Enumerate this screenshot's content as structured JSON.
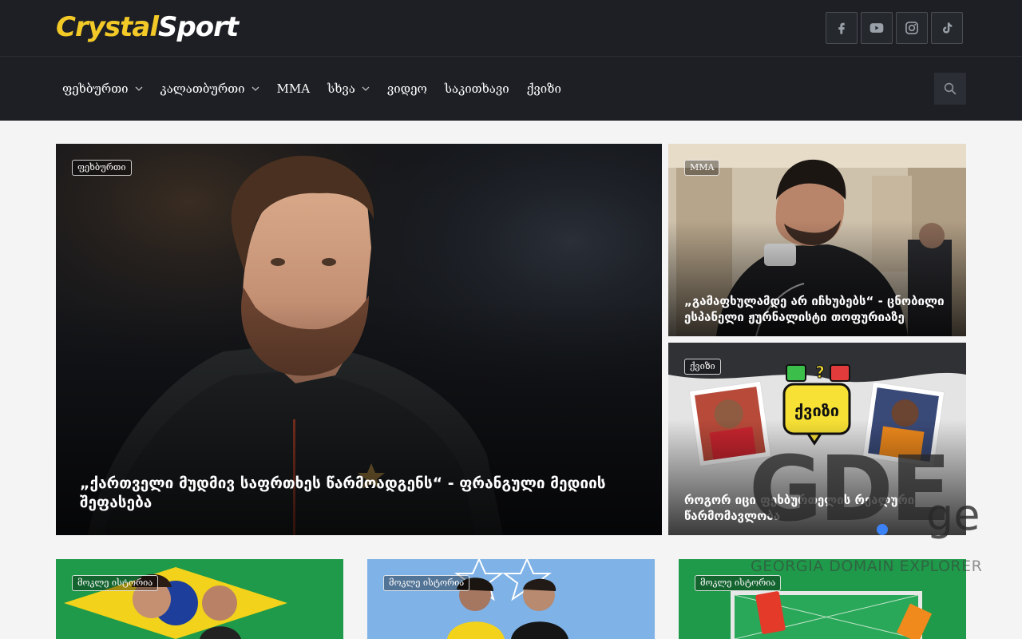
{
  "brand": {
    "logo_part1": "Crystal",
    "logo_part2": "Sport",
    "accent": "#f3c928"
  },
  "socials": [
    {
      "icon": "facebook-icon"
    },
    {
      "icon": "youtube-icon"
    },
    {
      "icon": "instagram-icon"
    },
    {
      "icon": "tiktok-icon"
    }
  ],
  "nav": {
    "items": [
      {
        "label": "ფეხბურთი",
        "has_dropdown": true
      },
      {
        "label": "კალათბურთი",
        "has_dropdown": true
      },
      {
        "label": "MMA",
        "has_dropdown": false
      },
      {
        "label": "სხვა",
        "has_dropdown": true
      },
      {
        "label": "ვიდეო",
        "has_dropdown": false
      },
      {
        "label": "საკითხავი",
        "has_dropdown": false
      },
      {
        "label": "ქვიზი",
        "has_dropdown": false
      }
    ],
    "search_icon": "search-icon"
  },
  "featured": {
    "main": {
      "category": "ფეხბურთი",
      "title": "„ქართველი მუდმივ საფრთხეს წარმოადგენს“ - ფრანგული მედიის შეფასება"
    },
    "side1": {
      "category": "MMA",
      "title": "„გამაფხულამდე არ იჩხუბებს“ - ცნობილი ესპანელი ჟურნალისტი თოფურიაზე"
    },
    "side2": {
      "category": "ქვიზი",
      "title": "როგორ იცი ფეხბურთელის რეალური წარმომავლობა",
      "image_text": "ქვიზი"
    }
  },
  "bottom_cards": [
    {
      "category": "მოკლე ისტორია"
    },
    {
      "category": "მოკლე ისტორია"
    },
    {
      "category": "მოკლე ისტორია"
    }
  ],
  "watermark": {
    "big": "GDE",
    "tld": "ge",
    "sub": "GEORGIA DOMAIN EXPLORER"
  }
}
